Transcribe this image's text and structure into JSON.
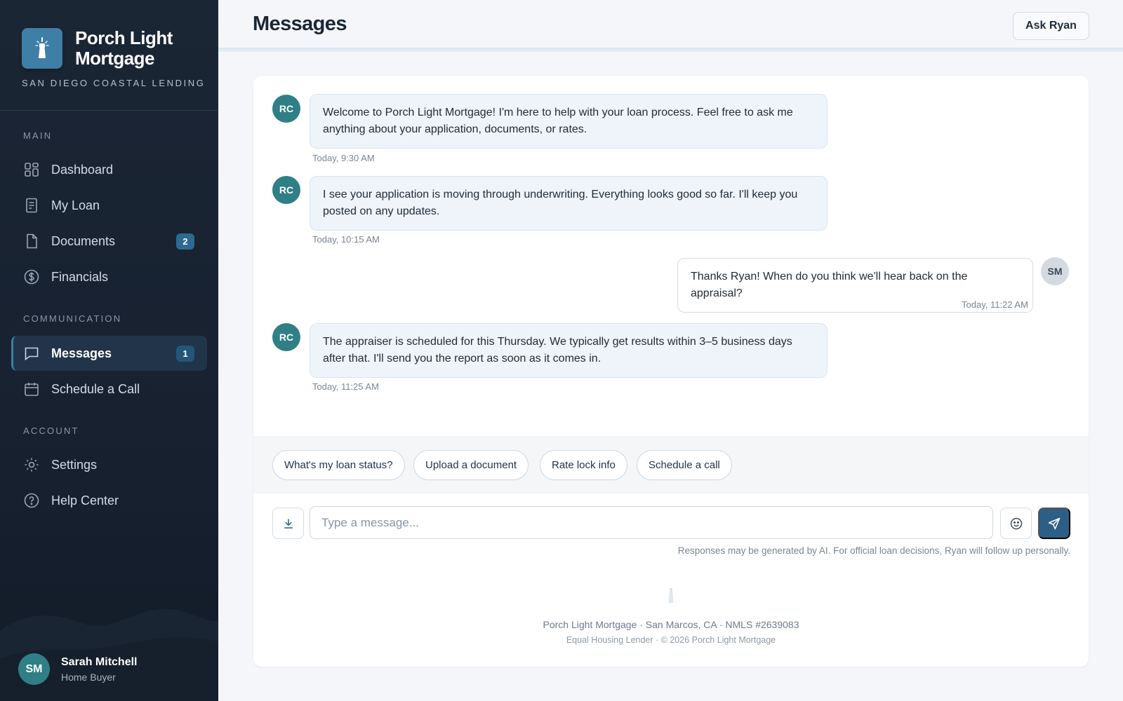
{
  "brand": {
    "name": "Porch Light Mortgage",
    "tagline": "SAN DIEGO COASTAL LENDING"
  },
  "nav": {
    "sections": {
      "main": "MAIN",
      "communication": "COMMUNICATION",
      "account": "ACCOUNT"
    },
    "items": [
      {
        "label": "Dashboard",
        "icon": "dashboard-icon"
      },
      {
        "label": "My Loan",
        "icon": "document-list-icon"
      },
      {
        "label": "Documents",
        "icon": "file-icon",
        "badge": "2"
      },
      {
        "label": "Financials",
        "icon": "dollar-icon"
      },
      {
        "label": "Messages",
        "icon": "chat-icon",
        "badge": "1",
        "active": true
      },
      {
        "label": "Schedule a Call",
        "icon": "calendar-icon"
      },
      {
        "label": "Settings",
        "icon": "gear-icon"
      },
      {
        "label": "Help Center",
        "icon": "help-icon"
      }
    ]
  },
  "user": {
    "initials": "SM",
    "name": "Sarah Mitchell",
    "role": "Home Buyer"
  },
  "header": {
    "title": "Messages",
    "ask_button": "Ask Ryan"
  },
  "messages": [
    {
      "from": "RC",
      "text": "Welcome to Porch Light Mortgage! I'm here to help with your loan process. Feel free to ask me anything about your application, documents, or rates.",
      "time": "Today, 9:30 AM"
    },
    {
      "from": "RC",
      "text": "I see your application is moving through underwriting. Everything looks good so far. I'll keep you posted on any updates.",
      "time": "Today, 10:15 AM"
    },
    {
      "from": "SM",
      "text": "Thanks Ryan! When do you think we'll hear back on the appraisal?",
      "time": "Today, 11:22 AM"
    },
    {
      "from": "RC",
      "text": "The appraiser is scheduled for this Thursday. We typically get results within 3–5 business days after that. I'll send you the report as soon as it comes in.",
      "time": "Today, 11:25 AM"
    }
  ],
  "quick_replies": [
    "What's my loan status?",
    "Upload a document",
    "Rate lock info",
    "Schedule a call"
  ],
  "composer": {
    "placeholder": "Type a message...",
    "disclaimer": "Responses may be generated by AI. For official loan decisions, Ryan will follow up personally."
  },
  "footer": {
    "line1": "Porch Light Mortgage · San Marcos, CA · NMLS #2639083",
    "line2": "Equal Housing Lender · © 2026 Porch Light Mortgage"
  },
  "colors": {
    "sidebar": "#1b2635",
    "accent": "#2d5f86",
    "avatar": "#2f7f86",
    "bubble": "#eef4fa"
  }
}
